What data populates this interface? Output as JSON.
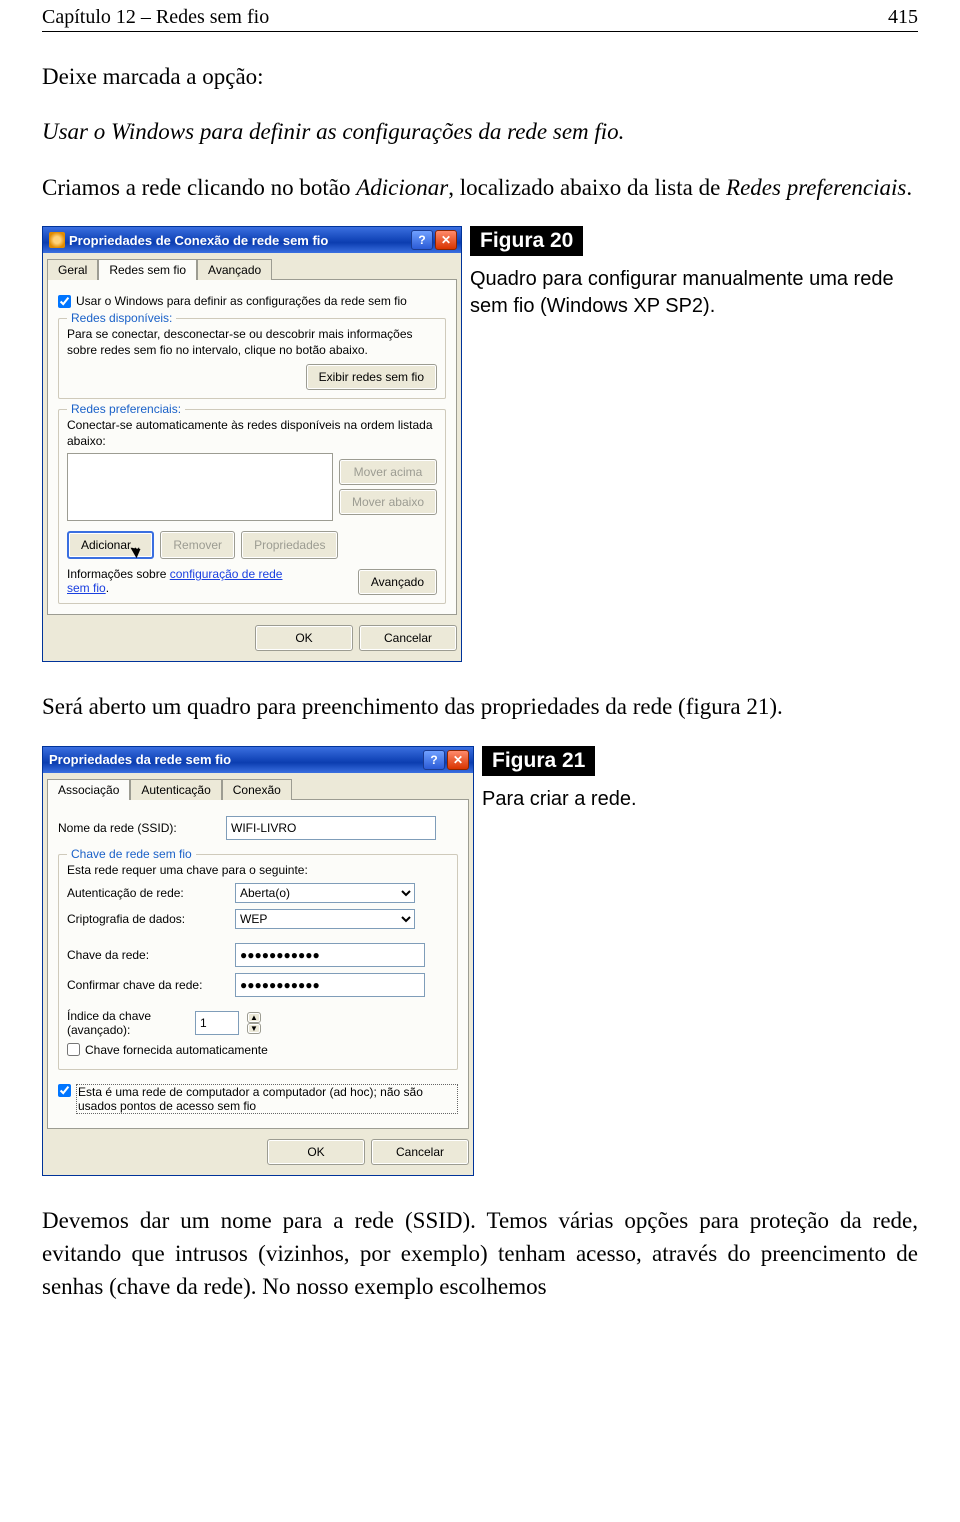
{
  "header": {
    "chapter": "Capítulo 12 – Redes sem fio",
    "page": "415"
  },
  "text": {
    "p1": "Deixe marcada a opção:",
    "p2": "Usar o Windows para definir as configurações da rede sem fio.",
    "p3a": "Criamos a rede clicando no botão ",
    "p3b": "Adicionar",
    "p3c": ", localizado abaixo da lista de ",
    "p3d": "Redes preferenciais",
    "p3e": ".",
    "p4": "Será aberto um quadro para preenchimento das propriedades da rede (figura 21).",
    "p5": "Devemos dar um nome para a rede (SSID). Temos várias opções para proteção da rede, evitando que intrusos (vizinhos, por exemplo) tenham acesso, através do preencimento de senhas (chave da rede). No nosso exemplo escolhemos"
  },
  "fig20": {
    "label": "Figura 20",
    "caption": "Quadro para configurar manualmente uma rede sem fio (Windows XP SP2)."
  },
  "fig21": {
    "label": "Figura 21",
    "caption": "Para criar a rede."
  },
  "win1": {
    "title": "Propriedades de Conexão de rede sem fio",
    "tabs": [
      "Geral",
      "Redes sem fio",
      "Avançado"
    ],
    "useWindows": "Usar o Windows para definir as configurações da rede sem fio",
    "grp_avail": "Redes disponíveis:",
    "availText": "Para se conectar, desconectar-se ou descobrir mais informações sobre redes sem fio no intervalo, clique no botão abaixo.",
    "btnExibir": "Exibir redes sem fio",
    "grp_pref": "Redes preferenciais:",
    "prefText": "Conectar-se automaticamente às redes disponíveis na ordem listada abaixo:",
    "btnUp": "Mover acima",
    "btnDown": "Mover abaixo",
    "btnAdd": "Adicionar...",
    "btnDel": "Remover",
    "btnProps": "Propriedades",
    "linkInfoA": "Informações sobre ",
    "linkInfoB": "configuração de rede sem fio",
    "linkInfoC": ".",
    "btnAdv": "Avançado",
    "ok": "OK",
    "cancel": "Cancelar"
  },
  "win2": {
    "title": "Propriedades da rede sem fio",
    "tabs": [
      "Associação",
      "Autenticação",
      "Conexão"
    ],
    "ssidLabel": "Nome da rede (SSID):",
    "ssidValue": "WIFI-LIVRO",
    "grp_key": "Chave de rede sem fio",
    "reqText": "Esta rede requer uma chave para o seguinte:",
    "authLabel": "Autenticação de rede:",
    "authValue": "Aberta(o)",
    "cryptLabel": "Criptografia de dados:",
    "cryptValue": "WEP",
    "keyLabel": "Chave da rede:",
    "keyMask": "●●●●●●●●●●●",
    "keyConfirm": "Confirmar chave da rede:",
    "idxLabel": "Índice da chave (avançado):",
    "idxValue": "1",
    "autoKey": "Chave fornecida automaticamente",
    "adhoc": "Esta é uma rede de computador a computador (ad hoc); não são usados pontos de acesso sem fio",
    "ok": "OK",
    "cancel": "Cancelar"
  }
}
